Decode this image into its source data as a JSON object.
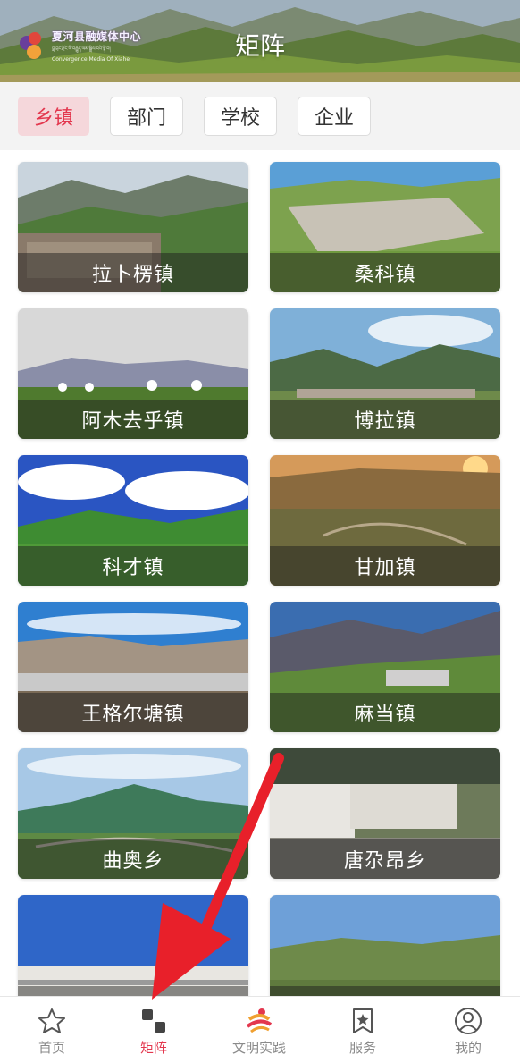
{
  "header": {
    "title": "矩阵",
    "logo": {
      "cn": "夏河县融媒体中心",
      "sub": "བླ་བྲང་རྫོང་གི་བརྒྱུད་ལམ་སྒྲིལ་བའི་ལྟེ་བ།",
      "en": "Convergence Media Of Xiahe"
    }
  },
  "tabs": [
    {
      "label": "乡镇",
      "active": true
    },
    {
      "label": "部门",
      "active": false
    },
    {
      "label": "学校",
      "active": false
    },
    {
      "label": "企业",
      "active": false
    }
  ],
  "cards": [
    {
      "label": "拉卜楞镇"
    },
    {
      "label": "桑科镇"
    },
    {
      "label": "阿木去乎镇"
    },
    {
      "label": "博拉镇"
    },
    {
      "label": "科才镇"
    },
    {
      "label": "甘加镇"
    },
    {
      "label": "王格尔塘镇"
    },
    {
      "label": "麻当镇"
    },
    {
      "label": "曲奥乡"
    },
    {
      "label": "唐尕昂乡"
    },
    {
      "label": ""
    },
    {
      "label": ""
    }
  ],
  "bottom_nav": [
    {
      "label": "首页",
      "icon": "star-icon",
      "active": false
    },
    {
      "label": "矩阵",
      "icon": "matrix-icon",
      "active": true
    },
    {
      "label": "文明实践",
      "icon": "practice-icon",
      "active": false
    },
    {
      "label": "服务",
      "icon": "service-icon",
      "active": false
    },
    {
      "label": "我的",
      "icon": "profile-icon",
      "active": false
    }
  ],
  "colors": {
    "accent": "#e3374e",
    "active_tab_bg": "#f5d7db",
    "tab_bar_bg": "#f3f3f3"
  }
}
